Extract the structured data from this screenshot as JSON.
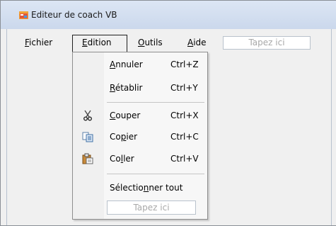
{
  "window": {
    "title": "Editeur de coach VB"
  },
  "menubar": {
    "items": [
      {
        "label": "Fichier",
        "mnemonic": "F",
        "rest": "ichier"
      },
      {
        "label": "Edition",
        "mnemonic": "E",
        "rest": "dition"
      },
      {
        "label": "Outils",
        "mnemonic": "O",
        "rest": "utils"
      },
      {
        "label": "Aide",
        "mnemonic": "A",
        "rest": "ide"
      }
    ],
    "type_here_placeholder": "Tapez ici"
  },
  "edition_menu": {
    "items": [
      {
        "pre": "",
        "mnemonic": "A",
        "rest": "nnuler",
        "shortcut": "Ctrl+Z",
        "icon": "none"
      },
      {
        "pre": "",
        "mnemonic": "R",
        "rest": "établir",
        "shortcut": "Ctrl+Y",
        "icon": "none"
      },
      {
        "pre": "",
        "mnemonic": "C",
        "rest": "ouper",
        "shortcut": "Ctrl+X",
        "icon": "scissors-icon"
      },
      {
        "pre": "Co",
        "mnemonic": "p",
        "rest": "ier",
        "shortcut": "Ctrl+C",
        "icon": "copy-icon"
      },
      {
        "pre": "Co",
        "mnemonic": "l",
        "rest": "ler",
        "shortcut": "Ctrl+V",
        "icon": "paste-icon"
      },
      {
        "pre": "Sélectio",
        "mnemonic": "n",
        "rest": "ner tout",
        "shortcut": "",
        "icon": "none"
      }
    ],
    "type_here_placeholder": "Tapez ici"
  },
  "colors": {
    "titlebar": "#cbd8ec",
    "menu_background": "#f7f7f7",
    "gutter": "#f0f0f0",
    "placeholder_text": "#a8a8a8"
  }
}
